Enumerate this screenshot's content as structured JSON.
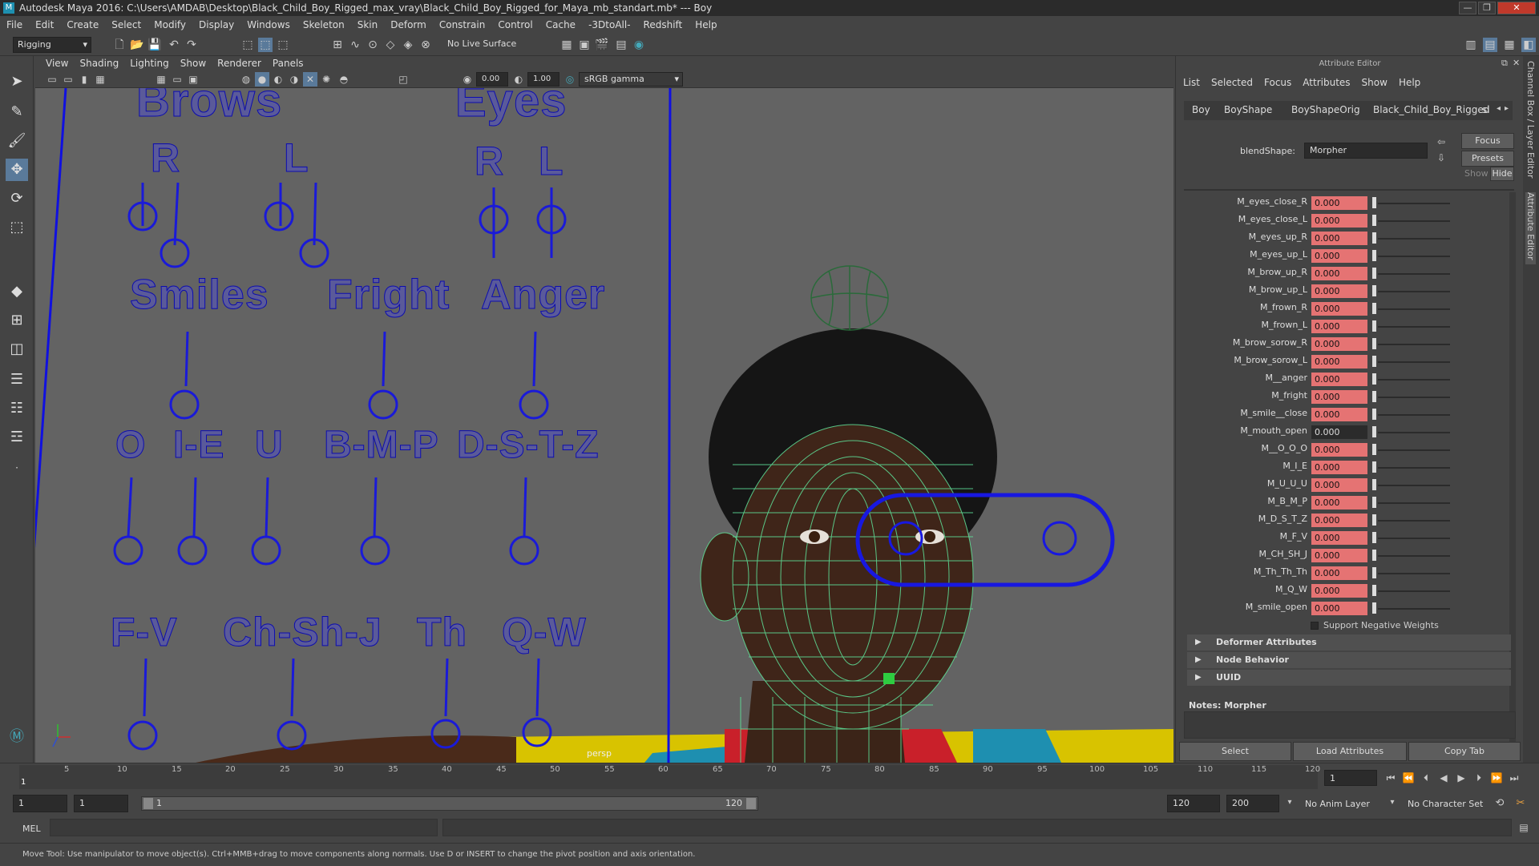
{
  "window": {
    "title": "Autodesk Maya 2016: C:\\Users\\AMDAB\\Desktop\\Black_Child_Boy_Rigged_max_vray\\Black_Child_Boy_Rigged_for_Maya_mb_standart.mb* --- Boy",
    "controls": [
      "—",
      "❐",
      "✕"
    ]
  },
  "menubar": [
    "File",
    "Edit",
    "Create",
    "Select",
    "Modify",
    "Display",
    "Windows",
    "Skeleton",
    "Skin",
    "Deform",
    "Constrain",
    "Control",
    "Cache",
    "-3DtoAll-",
    "Redshift",
    "Help"
  ],
  "shelf": {
    "mode": "Rigging",
    "live_surface": "No Live Surface"
  },
  "viewport": {
    "menu": [
      "View",
      "Shading",
      "Lighting",
      "Show",
      "Renderer",
      "Panels"
    ],
    "exposure": "0.00",
    "gamma": "1.00",
    "color_space": "sRGB gamma",
    "camera": "persp",
    "labels": {
      "brows": "Brows",
      "eyes": "Eyes",
      "r1": "R",
      "l1": "L",
      "r2": "R",
      "l2": "L",
      "smiles": "Smiles",
      "fright": "Fright",
      "anger": "Anger",
      "o": "O",
      "ie": "I-E",
      "u": "U",
      "bmp": "B-M-P",
      "dstz": "D-S-T-Z",
      "fv": "F-V",
      "chshj": "Ch-Sh-J",
      "th": "Th",
      "qw": "Q-W"
    }
  },
  "attribute_editor": {
    "title": "Attribute Editor",
    "menu": [
      "List",
      "Selected",
      "Focus",
      "Attributes",
      "Show",
      "Help"
    ],
    "tabs": [
      "Boy",
      "BoyShape",
      "BoyShapeOrig",
      "Black_Child_Boy_Rigged",
      "sl"
    ],
    "node_label": "blendShape:",
    "node_value": "Morpher",
    "focus_btn": "Focus",
    "presets_btn": "Presets",
    "show_label": "Show",
    "hide_label": "Hide",
    "attributes": [
      {
        "name": "M_eyes_close_R",
        "value": "0.000"
      },
      {
        "name": "M_eyes_close_L",
        "value": "0.000"
      },
      {
        "name": "M_eyes_up_R",
        "value": "0.000"
      },
      {
        "name": "M_eyes_up_L",
        "value": "0.000"
      },
      {
        "name": "M_brow_up_R",
        "value": "0.000"
      },
      {
        "name": "M_brow_up_L",
        "value": "0.000"
      },
      {
        "name": "M_frown_R",
        "value": "0.000"
      },
      {
        "name": "M_frown_L",
        "value": "0.000"
      },
      {
        "name": "M_brow_sorow_R",
        "value": "0.000"
      },
      {
        "name": "M_brow_sorow_L",
        "value": "0.000"
      },
      {
        "name": "M__anger",
        "value": "0.000"
      },
      {
        "name": "M_fright",
        "value": "0.000"
      },
      {
        "name": "M_smile__close",
        "value": "0.000"
      },
      {
        "name": "M_mouth_open",
        "value": "0.000"
      },
      {
        "name": "M__O_O_O",
        "value": "0.000"
      },
      {
        "name": "M_I_E",
        "value": "0.000"
      },
      {
        "name": "M_U_U_U",
        "value": "0.000"
      },
      {
        "name": "M_B_M_P",
        "value": "0.000"
      },
      {
        "name": "M_D_S_T_Z",
        "value": "0.000"
      },
      {
        "name": "M_F_V",
        "value": "0.000"
      },
      {
        "name": "M_CH_SH_J",
        "value": "0.000"
      },
      {
        "name": "M_Th_Th_Th",
        "value": "0.000"
      },
      {
        "name": "M_Q_W",
        "value": "0.000"
      },
      {
        "name": "M_smile_open",
        "value": "0.000"
      }
    ],
    "support_negative": "Support Negative Weights",
    "sections": [
      "Deformer Attributes",
      "Node Behavior",
      "UUID"
    ],
    "notes_label": "Notes:  Morpher",
    "buttons": {
      "select": "Select",
      "load": "Load Attributes",
      "copy": "Copy Tab"
    },
    "side_tabs": [
      "Channel Box / Layer Editor",
      "Attribute Editor"
    ]
  },
  "timeline": {
    "ticks": [
      "1",
      "5",
      "10",
      "15",
      "20",
      "25",
      "30",
      "35",
      "40",
      "45",
      "50",
      "55",
      "60",
      "65",
      "70",
      "75",
      "80",
      "85",
      "90",
      "95",
      "100",
      "105",
      "110",
      "115",
      "120"
    ],
    "current_frame": "1"
  },
  "range": {
    "start": "1",
    "start2": "1",
    "slider_start": "1",
    "slider_end": "120",
    "end": "120",
    "end2": "200",
    "anim_layer": "No Anim Layer",
    "character_set": "No Character Set"
  },
  "cmdline": {
    "label": "MEL"
  },
  "helpline": "Move Tool: Use manipulator to move object(s). Ctrl+MMB+drag to move components along normals. Use D or INSERT to change the pivot position and axis orientation."
}
